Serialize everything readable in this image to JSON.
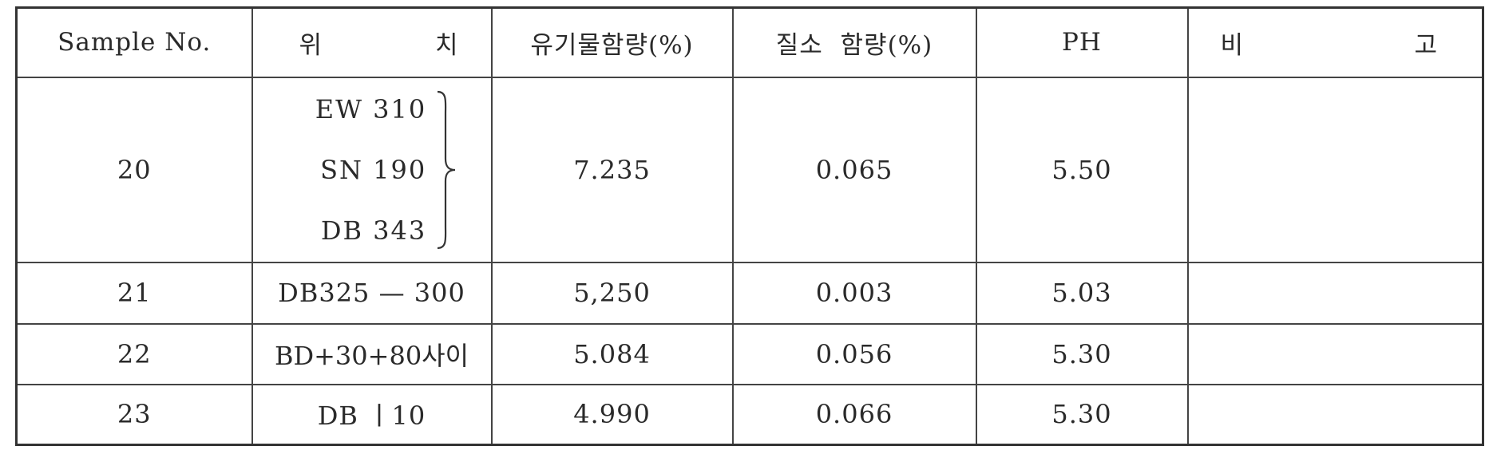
{
  "headers": {
    "sample_no": "Sample No.",
    "location_a": "위",
    "location_b": "치",
    "organic": "유기물함량(%)",
    "nitrogen": "질소  함량(%)",
    "ph": "PH",
    "remark_a": "비",
    "remark_b": "고"
  },
  "rows": [
    {
      "sample": "20",
      "location_lines": [
        "EW 310",
        "SN 190",
        "DB 343"
      ],
      "organic": "7.235",
      "nitrogen": "0.065",
      "ph": "5.50",
      "remark": ""
    },
    {
      "sample": "21",
      "location": "DB325 — 300",
      "organic": "5,250",
      "nitrogen": "0.003",
      "ph": "5.03",
      "remark": ""
    },
    {
      "sample": "22",
      "location": "BD+30+80사이",
      "organic": "5.084",
      "nitrogen": "0.056",
      "ph": "5.30",
      "remark": ""
    },
    {
      "sample": "23",
      "location": "DB ㅣ10",
      "organic": "4.990",
      "nitrogen": "0.066",
      "ph": "5.30",
      "remark": ""
    }
  ]
}
